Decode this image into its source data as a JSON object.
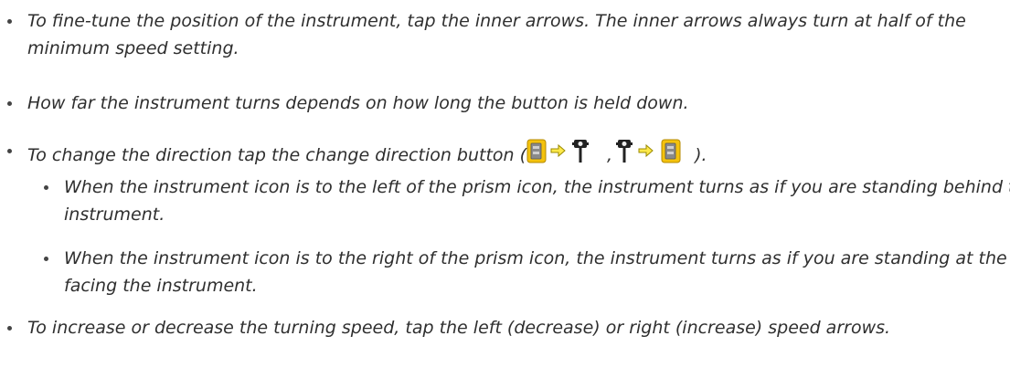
{
  "items": [
    {
      "text": "To fine-tune the position of the instrument, tap the inner arrows. The inner arrows always turn at half of the minimum speed setting."
    },
    {
      "text": "How far the instrument turns depends on how long the button is held down."
    },
    {
      "text_before": "To change the direction tap the change direction button (",
      "sep": ",",
      "text_after": ")."
    },
    {
      "text": "When the instrument icon is to the left of the prism icon, the instrument turns as if you are standing behind the instrument."
    },
    {
      "text": "When the instrument icon is to the right of the prism icon, the instrument turns as if you are standing at the pole facing the instrument."
    },
    {
      "text": "To increase or decrease the turning speed, tap the left (decrease) or right (increase) speed arrows."
    }
  ],
  "icons": {
    "instrument": "instrument-icon",
    "arrow": "arrow-right-icon",
    "prism": "prism-pole-icon"
  },
  "colors": {
    "text": "#2f2f2f",
    "instrument_yellow": "#f4c20d",
    "instrument_gray": "#8a8a8a",
    "arrow_yellow": "#ffe94a",
    "prism_dark": "#222222"
  }
}
